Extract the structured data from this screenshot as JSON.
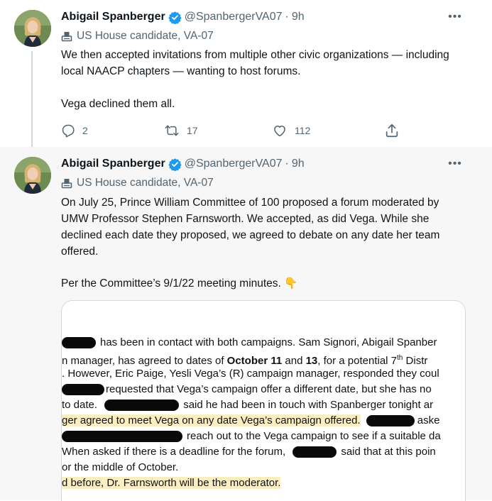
{
  "tweets": [
    {
      "author": {
        "name": "Abigail Spanberger",
        "handle": "@SpanbergerVA07",
        "time": "9h",
        "label": "US House candidate, VA-07"
      },
      "paragraphs": [
        "We then accepted invitations from multiple other civic organizations — including local NAACP chapters — wanting to host forums.",
        "Vega declined them all."
      ],
      "actions": {
        "replies": "2",
        "retweets": "17",
        "likes": "112"
      }
    },
    {
      "author": {
        "name": "Abigail Spanberger",
        "handle": "@SpanbergerVA07",
        "time": "9h",
        "label": "US House candidate, VA-07"
      },
      "paragraphs": [
        "On July 25, Prince William Committee of 100 proposed a forum moderated by UMW Professor Stephen Farnsworth. We accepted, as did Vega. While she declined each date they proposed, we agreed to debate on any date her team offered.",
        "Per the Committee’s 9/1/22 meeting minutes. 👇"
      ]
    }
  ],
  "document": {
    "lines": [
      {
        "segments": [
          {
            "t": "has been in contact with both campaigns. Sam Signori, Abigail Spanber"
          }
        ]
      },
      {
        "segments": [
          {
            "t": "n manager, has agreed to dates of "
          },
          {
            "t": "October 11",
            "b": true
          },
          {
            "t": " and "
          },
          {
            "t": "13",
            "b": true
          },
          {
            "t": ", for a potential 7"
          },
          {
            "t": "th",
            "sup": true
          },
          {
            "t": " Distr"
          }
        ]
      },
      {
        "segments": [
          {
            "t": ". However, Eric Paige, Yesli Vega’s (R) campaign manager, responded they coul"
          }
        ]
      },
      {
        "segments": [
          {
            "t": "requested that Vega’s campaign offer a different date, but she has no"
          }
        ]
      },
      {
        "segments": [
          {
            "t": "to date."
          },
          {
            "t": "said he had been in touch with Spanberger tonight ar"
          }
        ]
      },
      {
        "segments": [
          {
            "t": "ger agreed to meet Vega on any date Vega’s campaign offered.",
            "hl": true
          },
          {
            "t": "aske"
          }
        ]
      },
      {
        "segments": [
          {
            "t": "reach out to the Vega campaign to see if a suitable da"
          }
        ]
      },
      {
        "segments": [
          {
            "t": "When asked if there is a deadline for the forum,"
          },
          {
            "t": "said that at this poin"
          }
        ]
      },
      {
        "segments": [
          {
            "t": "or the middle of October."
          }
        ]
      },
      {
        "segments": [
          {
            "t": "d before, Dr. Farnsworth will be the moderator.",
            "hl": true
          }
        ]
      }
    ]
  },
  "icons": {
    "verified": "verified-badge-icon",
    "label": "ballot-box-icon",
    "more": "more-icon",
    "reply": "reply-icon",
    "retweet": "retweet-icon",
    "like": "heart-icon",
    "share": "share-icon",
    "emoji": "pointing-down-emoji"
  },
  "colors": {
    "verified": "#1d9bf0",
    "muted": "#536471",
    "highlight": "#fbeec1",
    "selected_bg": "#f7f7f7"
  }
}
